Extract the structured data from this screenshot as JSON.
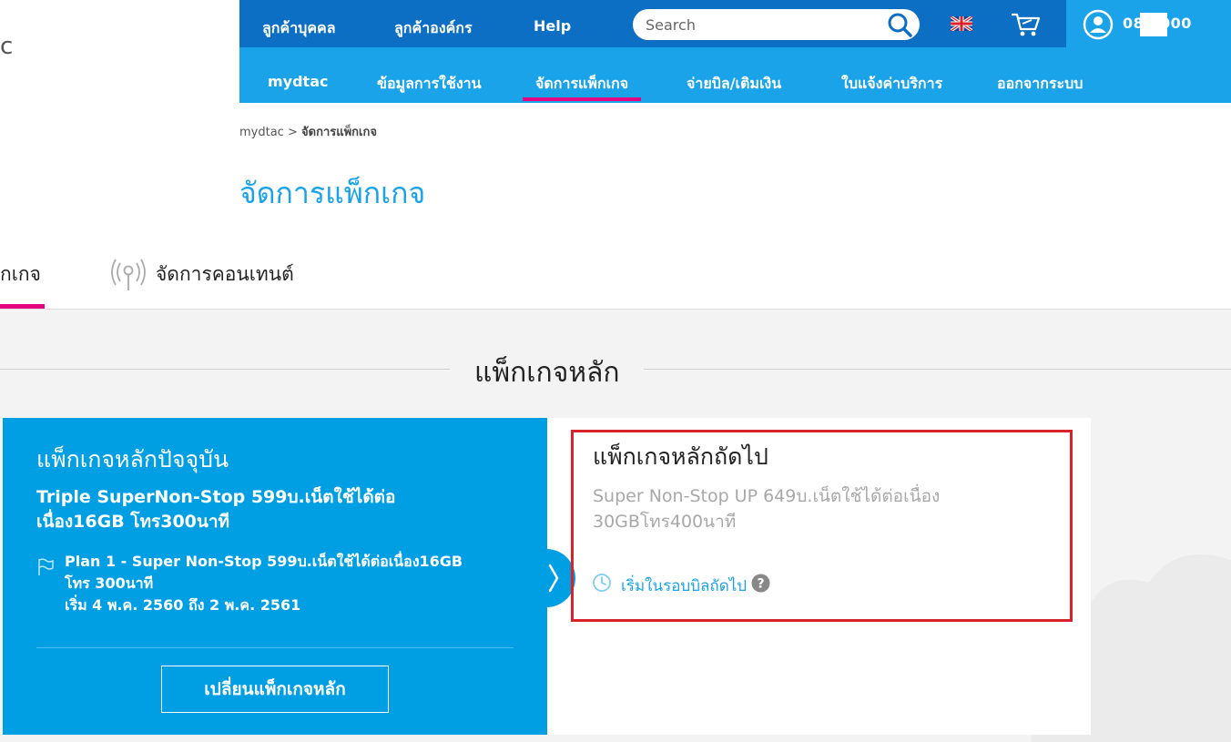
{
  "logo_fragment": "c",
  "top_nav": {
    "items": [
      "ลูกค้าบุคคล",
      "ลูกค้าองค์กร",
      "Help"
    ],
    "search_placeholder": "Search",
    "phone": "08    9000"
  },
  "sub_nav": {
    "items": [
      "mydtac",
      "ข้อมูลการใช้งาน",
      "จัดการแพ็กเกจ",
      "จ่ายบิล/เติมเงิน",
      "ใบแจ้งค่าบริการ",
      "ออกจากระบบ"
    ],
    "active_index": 2
  },
  "breadcrumb": {
    "root": "mydtac",
    "separator": ">",
    "current": "จัดการแพ็กเกจ"
  },
  "page_title": "จัดการแพ็กเกจ",
  "tabs": [
    {
      "label": "็กเกจ",
      "active": true
    },
    {
      "label": "จัดการคอนเทนต์",
      "active": false,
      "icon": "antenna-icon"
    }
  ],
  "section_title": "แพ็กเกจหลัก",
  "current_package": {
    "heading": "แพ็กเกจหลักปัจจุบัน",
    "name": "Triple SuperNon-Stop 599บ.เน็ตใช้ได้ต่อเนื่อง16GB โทร300นาที",
    "plan_line1": "Plan 1 - Super Non-Stop 599บ.เน็ตใช้ได้ต่อเนื่อง16GB โทร 300นาที",
    "plan_line2": "เริ่ม 4 พ.ค. 2560 ถึง 2 พ.ค. 2561",
    "change_button": "เปลี่ยนแพ็กเกจหลัก"
  },
  "next_package": {
    "heading": "แพ็กเกจหลักถัดไป",
    "name": "Super Non-Stop UP 649บ.เน็ตใช้ได้ต่อเนื่อง 30GBโทร400นาที",
    "start_note": "เริ่มในรอบบิลถัดไป"
  },
  "colors": {
    "dark_blue": "#0d6fc3",
    "light_blue": "#1aa3e8",
    "card_blue": "#009fe3",
    "accent_pink": "#e5007e",
    "highlight_red": "#d8232a"
  }
}
